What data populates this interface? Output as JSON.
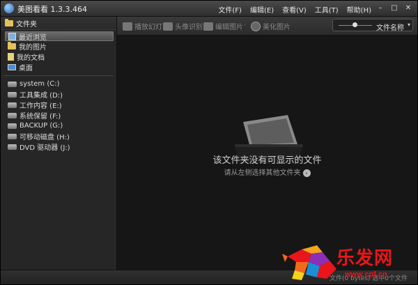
{
  "window": {
    "title": "美图看看 1.3.3.464",
    "minimize": "–",
    "maximize": "□",
    "close": "✕"
  },
  "menu": [
    "文件(F)",
    "编辑(E)",
    "查看(V)",
    "工具(T)",
    "帮助(H)"
  ],
  "sidebar": {
    "header": "文件夹",
    "quick": [
      {
        "label": "最近浏览",
        "icon": "recent-icon",
        "selected": true
      },
      {
        "label": "我的图片",
        "icon": "folder-icon"
      },
      {
        "label": "我的文档",
        "icon": "document-icon"
      },
      {
        "label": "桌面",
        "icon": "desktop-icon"
      }
    ],
    "drives": [
      {
        "label": "system (C:)"
      },
      {
        "label": "工具集成 (D:)"
      },
      {
        "label": "工作内容 (E:)"
      },
      {
        "label": "系统保留 (F:)"
      },
      {
        "label": "BACKUP (G:)"
      },
      {
        "label": "可移动磁盘 (H:)"
      },
      {
        "label": "DVD 驱动器 (J:)"
      }
    ]
  },
  "toolbar": {
    "slideshow": "播放幻灯",
    "face_detect": "头像识别",
    "edit_image": "编辑图片",
    "beautify": "美化图片",
    "sort_label": "文件名称",
    "sort_caret": "▾"
  },
  "main": {
    "empty_title": "该文件夹没有可显示的文件",
    "empty_hint": "请从左侧选择其他文件夹"
  },
  "status": {
    "text": "文件(0 bytes) 选中0个文件"
  },
  "watermark": {
    "brand": "乐发网",
    "url": "www.cpf.cn"
  },
  "colors": {
    "watermark_red": "#e8161a",
    "folder_yellow": "#e5c15c"
  }
}
